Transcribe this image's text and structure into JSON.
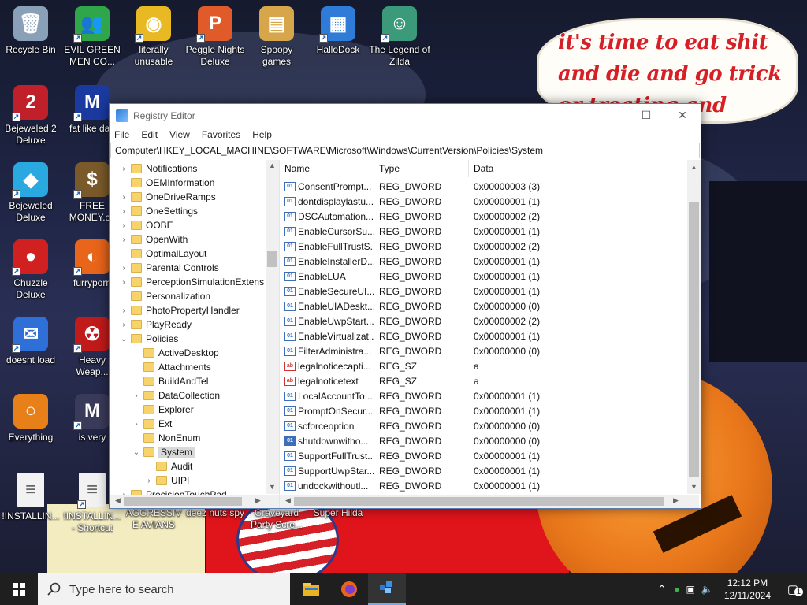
{
  "wallpaper": {
    "bubble_text": "it's time to eat shit and die and go trick or treating and vote!"
  },
  "desktop_icons": [
    {
      "label": "Recycle Bin",
      "icon": "recycle-bin-icon",
      "color": "#8aa0b8",
      "glyph": "🗑",
      "shortcut": false
    },
    {
      "label": "EVIL GREEN MEN CO...",
      "icon": "green-men-icon",
      "color": "#2fa64a",
      "glyph": "👥",
      "shortcut": true
    },
    {
      "label": "literally unusable",
      "icon": "chrome-icon",
      "color": "#e8b923",
      "glyph": "◉",
      "shortcut": true
    },
    {
      "label": "Peggle Nights Deluxe",
      "icon": "peggle-icon",
      "color": "#e05a2a",
      "glyph": "P",
      "shortcut": true
    },
    {
      "label": "Spoopy games",
      "icon": "folder-icon",
      "color": "#d8a64a",
      "glyph": "▤",
      "shortcut": false
    },
    {
      "label": "HalloDock",
      "icon": "windows-logo-icon",
      "color": "#2f7bd8",
      "glyph": "▦",
      "shortcut": true
    },
    {
      "label": "The Legend of Zilda",
      "icon": "zilda-icon",
      "color": "#3a9a7a",
      "glyph": "☺",
      "shortcut": true
    },
    {
      "label": "Bejeweled 2 Deluxe",
      "icon": "bejeweled-2-icon",
      "color": "#c0202a",
      "glyph": "2",
      "shortcut": true
    },
    {
      "label": "fat like darl",
      "icon": "mpl-icon",
      "color": "#1a3aa0",
      "glyph": "M",
      "shortcut": true
    },
    {
      "label": "Bejeweled Deluxe",
      "icon": "diamond-icon",
      "color": "#2aa8e0",
      "glyph": "◆",
      "shortcut": true
    },
    {
      "label": "FREE MONEY.co",
      "icon": "money-bag-icon",
      "color": "#7a5a2a",
      "glyph": "$",
      "shortcut": true
    },
    {
      "label": "Chuzzle Deluxe",
      "icon": "chuzzle-icon",
      "color": "#d02020",
      "glyph": "●",
      "shortcut": true
    },
    {
      "label": "furryporn",
      "icon": "firefox-icon",
      "color": "#e8651a",
      "glyph": "◐",
      "shortcut": true
    },
    {
      "label": "doesnt load",
      "icon": "thunderbird-icon",
      "color": "#2f6fd8",
      "glyph": "✉",
      "shortcut": true
    },
    {
      "label": "Heavy Weap...",
      "icon": "radiation-icon",
      "color": "#c01a1a",
      "glyph": "☢",
      "shortcut": true
    },
    {
      "label": "Everything",
      "icon": "search-magnifier-icon",
      "color": "#e8801a",
      "glyph": "○",
      "shortcut": false
    },
    {
      "label": "is very",
      "icon": "mp-icon",
      "color": "#3a3a5a",
      "glyph": "M",
      "shortcut": true
    },
    {
      "label": "!INSTALLIN...",
      "icon": "text-file-icon",
      "color": "#f2f2f2",
      "glyph": "≡",
      "shortcut": false
    },
    {
      "label": "!INSTALLIN... - Shortcut",
      "icon": "text-file-shortcut-icon",
      "color": "#f2f2f2",
      "glyph": "≡",
      "shortcut": true
    },
    {
      "label": "AGGRESSIVE AVIANS",
      "icon": "",
      "color": "",
      "glyph": "",
      "shortcut": false
    },
    {
      "label": "deez nuts spy",
      "icon": "",
      "color": "",
      "glyph": "",
      "shortcut": false
    },
    {
      "label": "Graveyard Party Scre...",
      "icon": "",
      "color": "",
      "glyph": "",
      "shortcut": false
    },
    {
      "label": "Super Hilda",
      "icon": "",
      "color": "",
      "glyph": "",
      "shortcut": false
    }
  ],
  "window": {
    "title": "Registry Editor",
    "menu": [
      "File",
      "Edit",
      "View",
      "Favorites",
      "Help"
    ],
    "address": "Computer\\HKEY_LOCAL_MACHINE\\SOFTWARE\\Microsoft\\Windows\\CurrentVersion\\Policies\\System",
    "tree": [
      {
        "label": "Notifications",
        "level": 0,
        "expander": ">"
      },
      {
        "label": "OEMInformation",
        "level": 0,
        "expander": ""
      },
      {
        "label": "OneDriveRamps",
        "level": 0,
        "expander": ">"
      },
      {
        "label": "OneSettings",
        "level": 0,
        "expander": ">"
      },
      {
        "label": "OOBE",
        "level": 0,
        "expander": ">"
      },
      {
        "label": "OpenWith",
        "level": 0,
        "expander": ">"
      },
      {
        "label": "OptimalLayout",
        "level": 0,
        "expander": ""
      },
      {
        "label": "Parental Controls",
        "level": 0,
        "expander": ">"
      },
      {
        "label": "PerceptionSimulationExtens",
        "level": 0,
        "expander": ">"
      },
      {
        "label": "Personalization",
        "level": 0,
        "expander": ""
      },
      {
        "label": "PhotoPropertyHandler",
        "level": 0,
        "expander": ">"
      },
      {
        "label": "PlayReady",
        "level": 0,
        "expander": ">"
      },
      {
        "label": "Policies",
        "level": 0,
        "expander": "v"
      },
      {
        "label": "ActiveDesktop",
        "level": 1,
        "expander": ""
      },
      {
        "label": "Attachments",
        "level": 1,
        "expander": ""
      },
      {
        "label": "BuildAndTel",
        "level": 1,
        "expander": ""
      },
      {
        "label": "DataCollection",
        "level": 1,
        "expander": ">"
      },
      {
        "label": "Explorer",
        "level": 1,
        "expander": ""
      },
      {
        "label": "Ext",
        "level": 1,
        "expander": ">"
      },
      {
        "label": "NonEnum",
        "level": 1,
        "expander": ""
      },
      {
        "label": "System",
        "level": 1,
        "expander": "v",
        "selected": true
      },
      {
        "label": "Audit",
        "level": 2,
        "expander": ""
      },
      {
        "label": "UIPI",
        "level": 2,
        "expander": ">"
      },
      {
        "label": "PrecisionTouchPad",
        "level": 0,
        "expander": ">"
      }
    ],
    "columns": [
      "Name",
      "Type",
      "Data"
    ],
    "values": [
      {
        "name": "ConsentPrompt...",
        "type": "REG_DWORD",
        "data": "0x00000003 (3)"
      },
      {
        "name": "dontdisplaylastu...",
        "type": "REG_DWORD",
        "data": "0x00000001 (1)"
      },
      {
        "name": "DSCAutomation...",
        "type": "REG_DWORD",
        "data": "0x00000002 (2)"
      },
      {
        "name": "EnableCursorSu...",
        "type": "REG_DWORD",
        "data": "0x00000001 (1)"
      },
      {
        "name": "EnableFullTrustS...",
        "type": "REG_DWORD",
        "data": "0x00000002 (2)"
      },
      {
        "name": "EnableInstallerD...",
        "type": "REG_DWORD",
        "data": "0x00000001 (1)"
      },
      {
        "name": "EnableLUA",
        "type": "REG_DWORD",
        "data": "0x00000001 (1)"
      },
      {
        "name": "EnableSecureUI...",
        "type": "REG_DWORD",
        "data": "0x00000001 (1)"
      },
      {
        "name": "EnableUIADeskt...",
        "type": "REG_DWORD",
        "data": "0x00000000 (0)"
      },
      {
        "name": "EnableUwpStart...",
        "type": "REG_DWORD",
        "data": "0x00000002 (2)"
      },
      {
        "name": "EnableVirtualizat...",
        "type": "REG_DWORD",
        "data": "0x00000001 (1)"
      },
      {
        "name": "FilterAdministra...",
        "type": "REG_DWORD",
        "data": "0x00000000 (0)"
      },
      {
        "name": "legalnoticecapti...",
        "type": "REG_SZ",
        "data": "a"
      },
      {
        "name": "legalnoticetext",
        "type": "REG_SZ",
        "data": "a"
      },
      {
        "name": "LocalAccountTo...",
        "type": "REG_DWORD",
        "data": "0x00000001 (1)"
      },
      {
        "name": "PromptOnSecur...",
        "type": "REG_DWORD",
        "data": "0x00000001 (1)"
      },
      {
        "name": "scforceoption",
        "type": "REG_DWORD",
        "data": "0x00000000 (0)"
      },
      {
        "name": "shutdownwitho...",
        "type": "REG_DWORD",
        "data": "0x00000000 (0)"
      },
      {
        "name": "SupportFullTrust...",
        "type": "REG_DWORD",
        "data": "0x00000001 (1)"
      },
      {
        "name": "SupportUwpStar...",
        "type": "REG_DWORD",
        "data": "0x00000001 (1)"
      },
      {
        "name": "undockwithoutl...",
        "type": "REG_DWORD",
        "data": "0x00000001 (1)"
      }
    ],
    "selected_value_index": 17
  },
  "taskbar": {
    "search_placeholder": "Type here to search",
    "apps": [
      {
        "icon": "file-explorer-icon",
        "active": false
      },
      {
        "icon": "firefox-icon",
        "active": false
      },
      {
        "icon": "registry-editor-icon",
        "active": true
      }
    ],
    "time": "12:12 PM",
    "date": "12/11/2024",
    "notification_count": "1"
  }
}
